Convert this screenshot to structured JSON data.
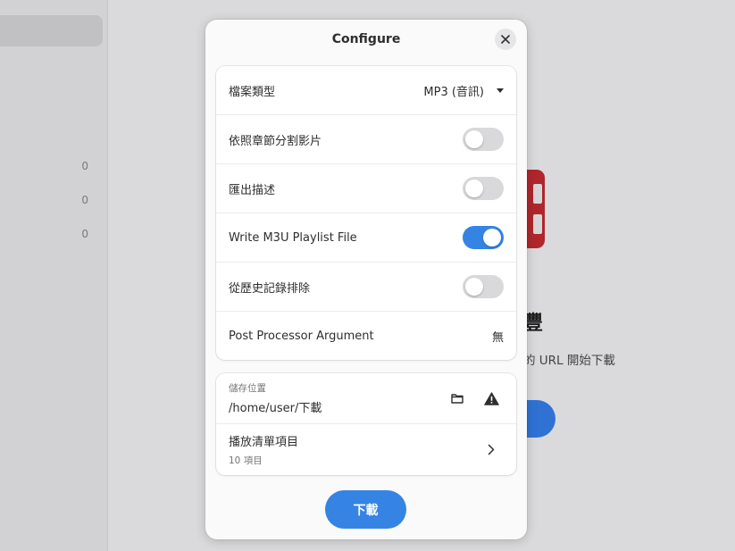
{
  "background": {
    "sidebar_counts": [
      "0",
      "0",
      "0"
    ],
    "heading": "豐",
    "hint": "的 URL 開始下載"
  },
  "dialog": {
    "title": "Configure",
    "close_icon": "close-icon",
    "options": [
      {
        "label": "檔案類型",
        "type": "dropdown",
        "value": "MP3 (音訊)"
      },
      {
        "label": "依照章節分割影片",
        "type": "toggle",
        "checked": false
      },
      {
        "label": "匯出描述",
        "type": "toggle",
        "checked": false
      },
      {
        "label": "Write M3U Playlist File",
        "type": "toggle",
        "checked": true
      },
      {
        "label": "從歷史記錄排除",
        "type": "toggle",
        "checked": false
      },
      {
        "label": "Post Processor Argument",
        "type": "value",
        "value": "無"
      }
    ],
    "save_location": {
      "caption": "儲存位置",
      "path": "/home/user/下載",
      "folder_icon": "folder-icon",
      "warning_icon": "warning-icon"
    },
    "playlist": {
      "title": "播放清單項目",
      "subtitle": "10 項目",
      "chevron_icon": "chevron-right-icon"
    },
    "download_label": "下載"
  },
  "colors": {
    "accent": "#3584e4",
    "brand_red": "#b0262c"
  }
}
